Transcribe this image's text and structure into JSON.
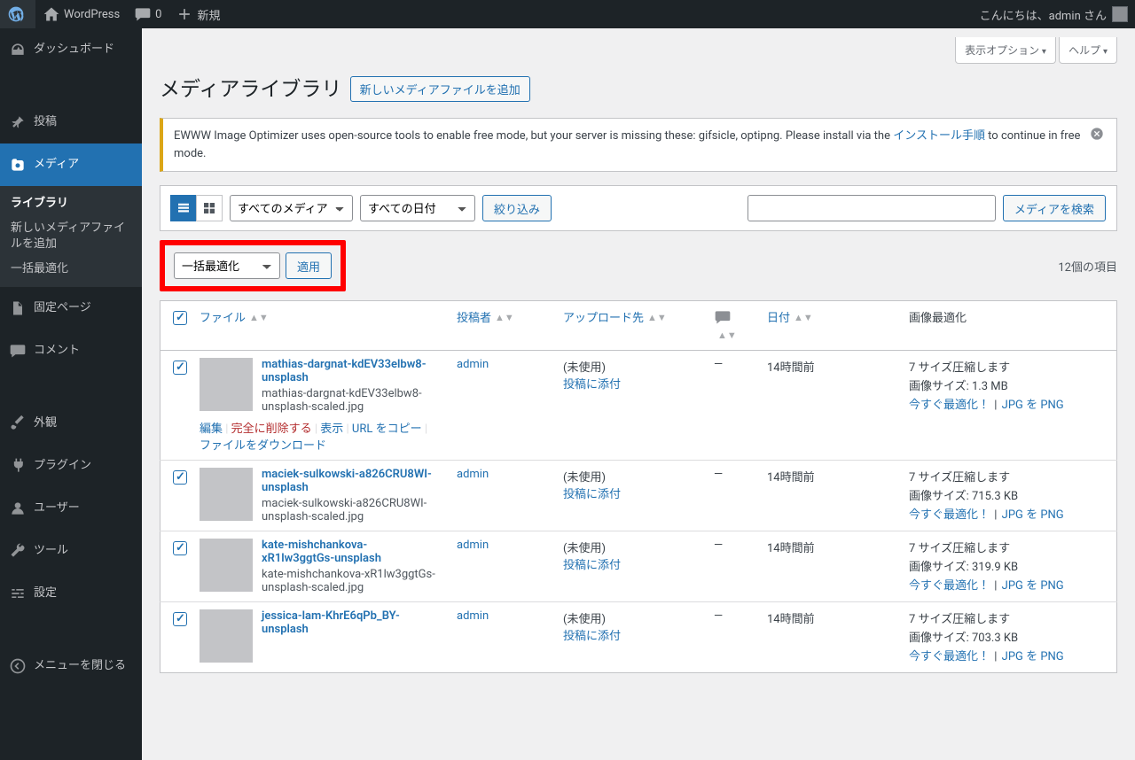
{
  "adminbar": {
    "site_name": "WordPress",
    "comments_count": "0",
    "new_label": "新規",
    "greeting": "こんにちは、admin さん"
  },
  "menu": {
    "dashboard": "ダッシュボード",
    "posts": "投稿",
    "media": "メディア",
    "library": "ライブラリ",
    "add_new": "新しいメディアファイルを追加",
    "bulk_optimize": "一括最適化",
    "pages": "固定ページ",
    "comments": "コメント",
    "appearance": "外観",
    "plugins": "プラグイン",
    "users": "ユーザー",
    "tools": "ツール",
    "settings": "設定",
    "collapse": "メニューを閉じる"
  },
  "screen_meta": {
    "options": "表示オプション",
    "help": "ヘルプ"
  },
  "page": {
    "heading": "メディアライブラリ",
    "add_button": "新しいメディアファイルを追加"
  },
  "notice": {
    "text_before": "EWWW Image Optimizer uses open-source tools to enable free mode, but your server is missing these: gifsicle, optipng. Please install via the ",
    "link_text": "インストール手順",
    "text_after": " to continue in free mode."
  },
  "filters": {
    "all_media": "すべてのメディア",
    "all_dates": "すべての日付",
    "filter_button": "絞り込み",
    "search_button": "メディアを検索"
  },
  "bulk": {
    "action": "一括最適化",
    "apply": "適用"
  },
  "count_label": "12個の項目",
  "columns": {
    "file": "ファイル",
    "author": "投稿者",
    "uploaded_to": "アップロード先",
    "date": "日付",
    "optimization": "画像最適化"
  },
  "row_actions": {
    "edit": "編集",
    "delete": "完全に削除する",
    "view": "表示",
    "copy_url": "URL をコピー",
    "download": "ファイルをダウンロード"
  },
  "common": {
    "unattached": "(未使用)",
    "attach": "投稿に添付",
    "dash": "—"
  },
  "optimize": {
    "sizes_line": "7 サイズ圧縮します",
    "image_size_label": "画像サイズ: ",
    "optimize_now": "今すぐ最適化！",
    "jpg_to_png": "JPG を PNG"
  },
  "rows": [
    {
      "title": "mathias-dargnat-kdEV33elbw8-unsplash",
      "filename": "mathias-dargnat-kdEV33elbw8-unsplash-scaled.jpg",
      "author": "admin",
      "date": "14時間前",
      "size": "1.3 MB",
      "show_actions": true,
      "thumb_class": "thumb1"
    },
    {
      "title": "maciek-sulkowski-a826CRU8WI-unsplash",
      "filename": "maciek-sulkowski-a826CRU8WI-unsplash-scaled.jpg",
      "author": "admin",
      "date": "14時間前",
      "size": "715.3 KB",
      "show_actions": false,
      "thumb_class": "thumb2"
    },
    {
      "title": "kate-mishchankova-xR1lw3ggtGs-unsplash",
      "filename": "kate-mishchankova-xR1lw3ggtGs-unsplash-scaled.jpg",
      "author": "admin",
      "date": "14時間前",
      "size": "319.9 KB",
      "show_actions": false,
      "thumb_class": "thumb3"
    },
    {
      "title": "jessica-lam-KhrE6qPb_BY-unsplash",
      "filename": "",
      "author": "admin",
      "date": "14時間前",
      "size": "703.3 KB",
      "show_actions": false,
      "thumb_class": "thumb4"
    }
  ]
}
